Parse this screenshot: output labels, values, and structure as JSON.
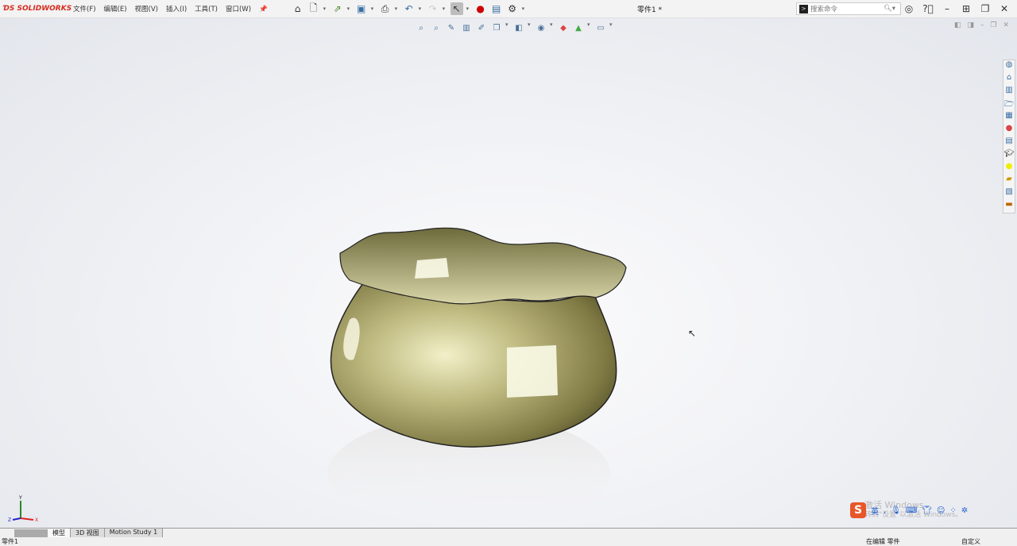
{
  "app": {
    "brand": "SOLIDWORKS",
    "document_title": "零件1 *"
  },
  "menu": [
    "文件(F)",
    "编辑(E)",
    "视图(V)",
    "插入(I)",
    "工具(T)",
    "窗口(W)"
  ],
  "toolbar_icons": [
    "home-icon",
    "new-document-icon",
    "open-icon",
    "save-icon",
    "print-icon",
    "undo-icon",
    "redo-icon",
    "select-icon",
    "traffic-light-icon",
    "options-list-icon",
    "gear-icon"
  ],
  "search": {
    "placeholder": "搜索命令"
  },
  "window_buttons": [
    "user-icon",
    "help-icon",
    "minimize-icon",
    "tile-icon",
    "restore-icon",
    "close-icon"
  ],
  "tabs": [
    "模型",
    "3D 视图",
    "Motion Study 1"
  ],
  "status": {
    "left": "零件1",
    "mode": "在编辑 零件",
    "custom": "自定义"
  },
  "watermark": {
    "line1": "激活 Windows",
    "line2": "转到\"设置\"以激活 Windows。"
  },
  "ime": {
    "lang": "英"
  },
  "triad": {
    "x": "X",
    "y": "Y",
    "z": "Z"
  },
  "colors": {
    "brand": "#d52b1e",
    "model": "#b8b37a"
  }
}
